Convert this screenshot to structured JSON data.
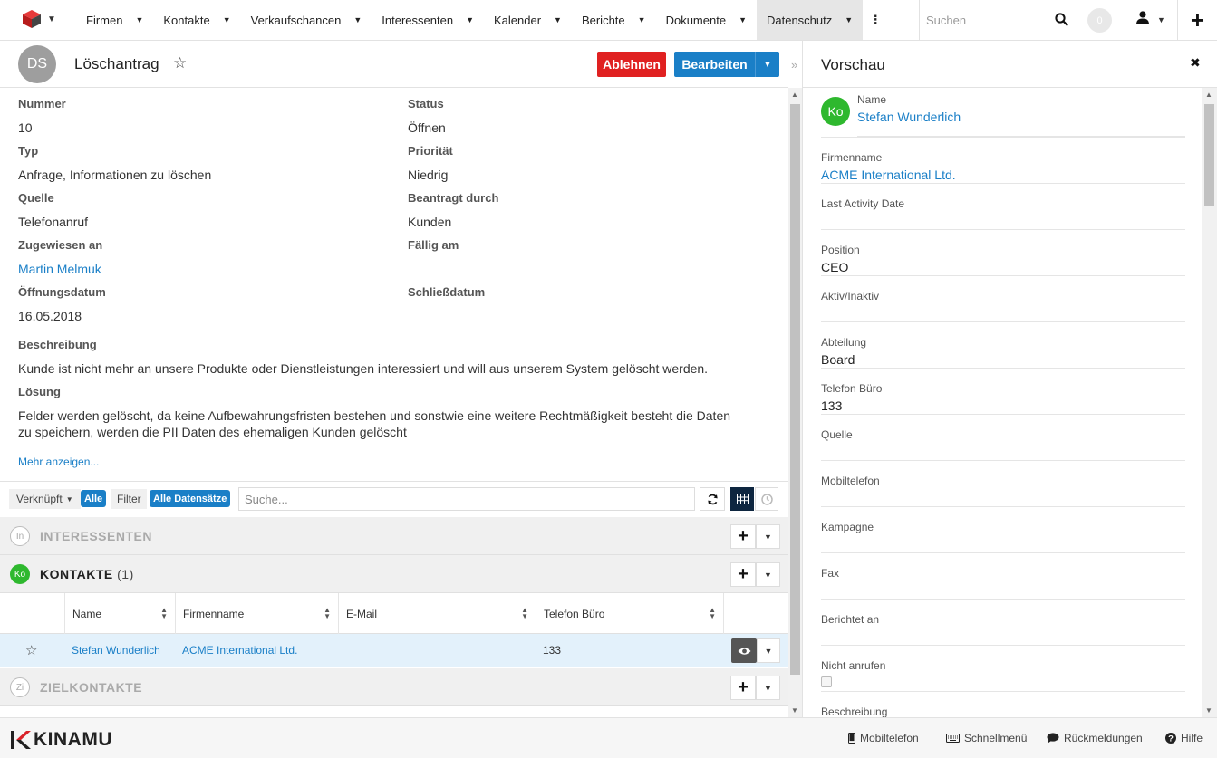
{
  "nav": {
    "items": [
      {
        "label": "Firmen"
      },
      {
        "label": "Kontakte"
      },
      {
        "label": "Verkaufschancen"
      },
      {
        "label": "Interessenten"
      },
      {
        "label": "Kalender"
      },
      {
        "label": "Berichte"
      },
      {
        "label": "Dokumente"
      },
      {
        "label": "Datenschutz",
        "active": true
      }
    ],
    "search_placeholder": "Suchen",
    "notification_count": "0"
  },
  "record": {
    "avatar": "DS",
    "title": "Löschantrag",
    "btn_reject": "Ablehnen",
    "btn_edit": "Bearbeiten"
  },
  "details": {
    "nummer_label": "Nummer",
    "nummer": "10",
    "status_label": "Status",
    "status": "Öffnen",
    "typ_label": "Typ",
    "typ": "Anfrage, Informationen zu löschen",
    "prioritaet_label": "Priorität",
    "prioritaet": "Niedrig",
    "quelle_label": "Quelle",
    "quelle": "Telefonanruf",
    "beantragt_label": "Beantragt durch",
    "beantragt": "Kunden",
    "zugewiesen_label": "Zugewiesen an",
    "zugewiesen": "Martin Melmuk",
    "faellig_label": "Fällig am",
    "oeffnungsdatum_label": "Öffnungsdatum",
    "oeffnungsdatum": "16.05.2018",
    "schliessdatum_label": "Schließdatum",
    "beschreibung_label": "Beschreibung",
    "beschreibung": "Kunde ist nicht mehr an unsere Produkte oder Dienstleistungen interessiert und will aus unserem System gelöscht werden.",
    "loesung_label": "Lösung",
    "loesung_line1": "Felder werden gelöscht, da keine Aufbewahrungsfristen bestehen und sonstwie eine weitere Rechtmäßigkeit besteht die Daten",
    "loesung_line2": "zu speichern, werden die PII Daten des ehemaligen Kunden gelöscht",
    "mehr": "Mehr anzeigen..."
  },
  "subbar": {
    "verknuepft": "Verknüpft",
    "alle": "Alle",
    "filter": "Filter",
    "alle_datensaetze": "Alle Datensätze",
    "search_placeholder": "Suche..."
  },
  "subpanels": {
    "interessenten": {
      "badge": "In",
      "title": "INTERESSENTEN"
    },
    "kontakte": {
      "badge": "Ko",
      "title": "KONTAKTE",
      "count": "(1)"
    },
    "zielkontakte": {
      "badge": "Zi",
      "title": "ZIELKONTAKTE"
    }
  },
  "contacts_table": {
    "columns": [
      "Name",
      "Firmenname",
      "E-Mail",
      "Telefon Büro"
    ],
    "rows": [
      {
        "name": "Stefan Wunderlich",
        "firma": "ACME International Ltd.",
        "email": "",
        "telefon": "133"
      }
    ]
  },
  "preview": {
    "title": "Vorschau",
    "avatar": "Ko",
    "fields": [
      {
        "label": "Name",
        "value": "Stefan Wunderlich",
        "link": true
      },
      {
        "label": "Firmenname",
        "value": "ACME International Ltd.",
        "link": true
      },
      {
        "label": "Last Activity Date",
        "value": ""
      },
      {
        "label": "Position",
        "value": "CEO"
      },
      {
        "label": "Aktiv/Inaktiv",
        "value": ""
      },
      {
        "label": "Abteilung",
        "value": "Board"
      },
      {
        "label": "Telefon Büro",
        "value": "133"
      },
      {
        "label": "Quelle",
        "value": ""
      },
      {
        "label": "Mobiltelefon",
        "value": ""
      },
      {
        "label": "Kampagne",
        "value": ""
      },
      {
        "label": "Fax",
        "value": ""
      },
      {
        "label": "Berichtet an",
        "value": ""
      },
      {
        "label": "Nicht anrufen",
        "value": "",
        "checkbox": true,
        "checked": false
      },
      {
        "label": "Beschreibung",
        "value": ""
      }
    ]
  },
  "footer": {
    "brand": "KINAMU",
    "links": [
      "Mobiltelefon",
      "Schnellmenü",
      "Rückmeldungen",
      "Hilfe"
    ]
  },
  "colors": {
    "accent": "#1a7fc7",
    "danger": "#e02121",
    "contact_green": "#2eb82e",
    "logo_red": "#d9232a"
  }
}
